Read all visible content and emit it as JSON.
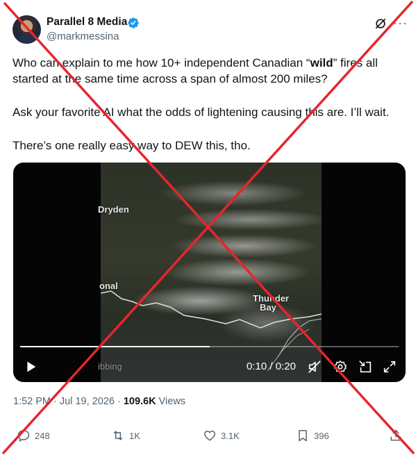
{
  "author": {
    "name": "Parallel 8 Media",
    "handle": "@markmessina"
  },
  "tweet": {
    "para1_a": "Who can explain to me how 10+ independent Canadian “",
    "para1_bold": "wild",
    "para1_b": "” fires all started at the same time across a span of almost 200 miles?",
    "para2": "Ask your favorite AI what the odds of lightening causing this are.  I’ll wait.",
    "para3": "There’s one really easy way to DEW this, tho."
  },
  "video": {
    "labels": {
      "dryden": "Dryden",
      "national": "onal",
      "thunder": "Thunder",
      "bay": "Bay",
      "gibbing": "ibbing"
    },
    "current_time": "0:10",
    "separator": "/",
    "duration": "0:20",
    "progress_fraction": 0.5
  },
  "meta": {
    "time": "1:52 PM",
    "dot1": "·",
    "date": "Jul 19, 2026",
    "dot2": "·",
    "views_count": "109.6K",
    "views_label": "Views"
  },
  "actions": {
    "replies": "248",
    "reposts": "1K",
    "likes": "3.1K",
    "bookmarks": "396"
  },
  "colors": {
    "verified_blue": "#1d9bf0",
    "overlay_red": "#e5262c",
    "secondary_text": "#536471"
  }
}
